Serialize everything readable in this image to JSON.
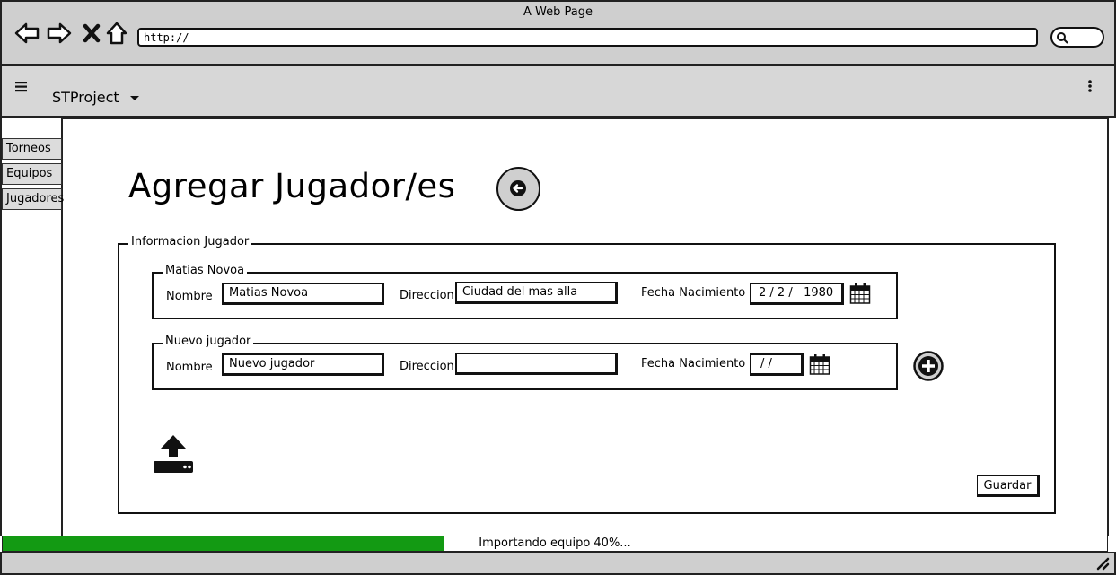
{
  "browser": {
    "title": "A Web Page",
    "url": "http://"
  },
  "appbar": {
    "project": "STProject"
  },
  "sidebar": {
    "items": [
      {
        "label": "Torneos"
      },
      {
        "label": "Equipos"
      },
      {
        "label": "Jugadores"
      }
    ]
  },
  "page": {
    "title": "Agregar Jugador/es"
  },
  "form": {
    "legend": "Informacion Jugador",
    "players": [
      {
        "legend": "Matias Novoa",
        "name_label": "Nombre",
        "name_value": "Matias Novoa",
        "address_label": "Direccion",
        "address_value": "Ciudad del mas alla",
        "birth_label": "Fecha Nacimiento",
        "birth_value": "2 / 2 /   1980"
      },
      {
        "legend": "Nuevo jugador",
        "name_label": "Nombre",
        "name_value": "Nuevo jugador",
        "address_label": "Direccion",
        "address_value": "",
        "birth_label": "Fecha Nacimiento",
        "birth_value": "/ /"
      }
    ],
    "save_label": "Guardar"
  },
  "progress": {
    "text": "Importando equipo 40%...",
    "fraction": 0.4,
    "color": "#139a13"
  },
  "icons": [
    "back-arrow-icon",
    "forward-arrow-icon",
    "close-icon",
    "home-icon",
    "search-icon",
    "hamburger-menu-icon",
    "caret-down-icon",
    "kebab-menu-icon",
    "back-circle-icon",
    "calendar-icon",
    "add-circle-icon",
    "upload-icon",
    "resize-grip-icon"
  ]
}
